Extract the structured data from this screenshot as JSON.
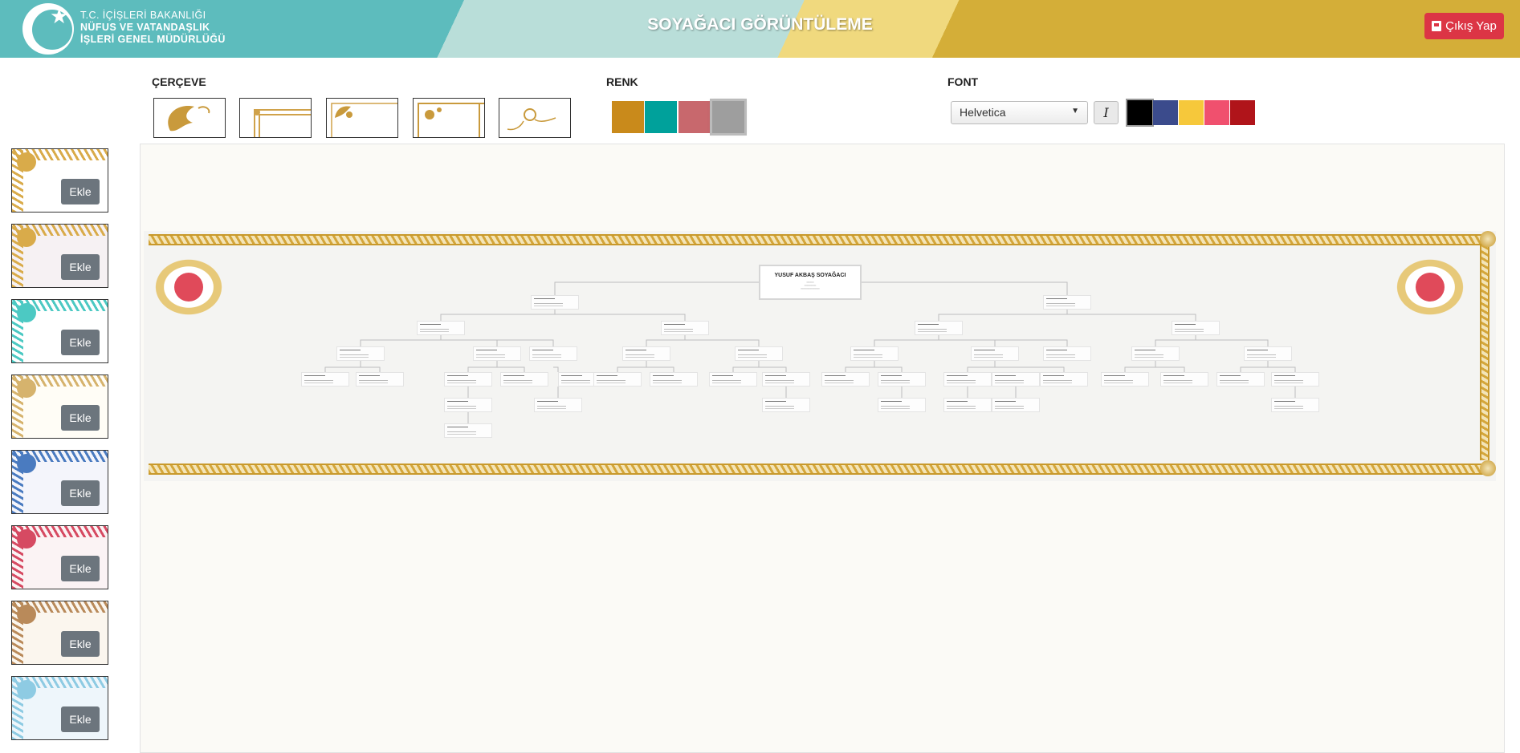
{
  "header": {
    "org_line1": "T.C. İÇİŞLERİ BAKANLIĞI",
    "org_line2": "NÜFUS VE VATANDAŞLIK",
    "org_line3": "İŞLERİ GENEL MÜDÜRLÜĞÜ",
    "title": "SOYAĞACI GÖRÜNTÜLEME",
    "logout_label": "Çıkış Yap"
  },
  "toolbar": {
    "frame_label": "ÇERÇEVE",
    "color_label": "RENK",
    "font_label": "FONT",
    "color_swatches": [
      "#c98a1b",
      "#00a19b",
      "#c8686d",
      "#9e9e9e"
    ],
    "selected_color_index": 3,
    "font_value": "Helvetica",
    "italic_label": "I",
    "font_colors": [
      "#000000",
      "#3b4b8c",
      "#f6c83b",
      "#f0506e",
      "#b0141a"
    ],
    "selected_font_color_index": 0
  },
  "sidebar": {
    "add_label": "Ekle",
    "templates": [
      {
        "accent": "#d9ab4a",
        "bg": "#ffffff"
      },
      {
        "accent": "#d9ab4a",
        "bg": "#f6f1f3"
      },
      {
        "accent": "#4cc9c3",
        "bg": "#ffffff"
      },
      {
        "accent": "#d6b36d",
        "bg": "#fffdf6"
      },
      {
        "accent": "#4a7bc0",
        "bg": "#f4f5fb"
      },
      {
        "accent": "#d64a62",
        "bg": "#fbf3f4"
      },
      {
        "accent": "#b98a5a",
        "bg": "#fbf6ee"
      },
      {
        "accent": "#8ecbe3",
        "bg": "#eef6fb"
      }
    ]
  },
  "tree": {
    "title": "YUSUF AKBAŞ SOYAĞACI"
  }
}
